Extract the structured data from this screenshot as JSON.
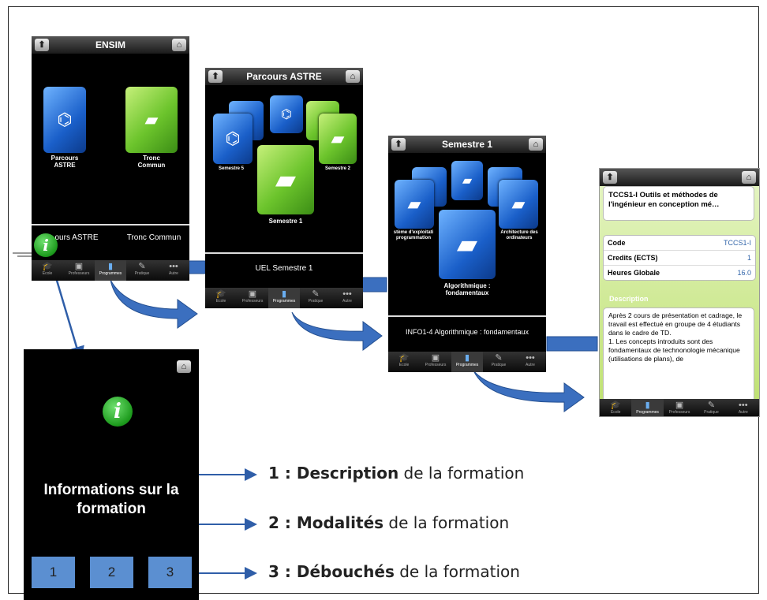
{
  "screen1": {
    "title": "ENSIM",
    "tile1_label": "Parcours ASTRE",
    "tile2_label": "Tronc Commun",
    "subtitle_left": "ours ASTRE",
    "subtitle_right": "Tronc Commun"
  },
  "screen2": {
    "title": "Parcours ASTRE",
    "tile_left_label": "Semestre 5",
    "tile_right_label": "Semestre 2",
    "center_label": "Semestre 1",
    "subtitle": "UEL Semestre 1"
  },
  "screen3": {
    "title": "Semestre 1",
    "left_label": "stème d'exploitati programmation",
    "right_label": "Architecture des ordinateurs",
    "center_label": "Algorithmique : fondamentaux",
    "subtitle": "INFO1-4 Algorithmique : fondamentaux"
  },
  "detail": {
    "title": "TCCS1-I Outils et méthodes de l'ingénieur en conception mé…",
    "rows": [
      {
        "key": "Code",
        "value": "TCCS1-I"
      },
      {
        "key": "Credits (ECTS)",
        "value": "1"
      },
      {
        "key": "Heures Globale",
        "value": "16.0"
      }
    ],
    "section": "Description",
    "text": "Après 2 cours de présentation et cadrage, le travail est effectué en groupe de 4 étudiants dans le cadre de TD.\n1. Les concepts introduits sont des fondamentaux de technonologie mécanique (utilisations de plans), de"
  },
  "tabs_a": [
    "Ecole",
    "Professeurs",
    "Programmes",
    "Pratique",
    "Autre"
  ],
  "tabs_b": [
    "Ecole",
    "Programmes",
    "Professeurs",
    "Pratique",
    "Autre"
  ],
  "info": {
    "title": "Informations sur la formation",
    "buttons": [
      "1",
      "2",
      "3"
    ]
  },
  "legend": [
    {
      "num": "1 : ",
      "bold": "Description",
      "rest": " de la formation"
    },
    {
      "num": "2 : ",
      "bold": "Modalités",
      "rest": " de la formation"
    },
    {
      "num": "3 : ",
      "bold": "Débouchés",
      "rest": " de la formation"
    }
  ],
  "icons": {
    "back": "up-arrow-icon",
    "home": "home-icon",
    "info": "info-icon",
    "tabs": [
      "graduation-cap-icon",
      "briefcase-icon",
      "book-icon",
      "wrench-icon",
      "more-icon"
    ]
  },
  "colors": {
    "blue_tile": "#1a5fc9",
    "green_tile": "#6cc42c",
    "info_green": "#1c9a1c",
    "number_button": "#5b8fd1",
    "arrow": "#2f5ea8"
  }
}
